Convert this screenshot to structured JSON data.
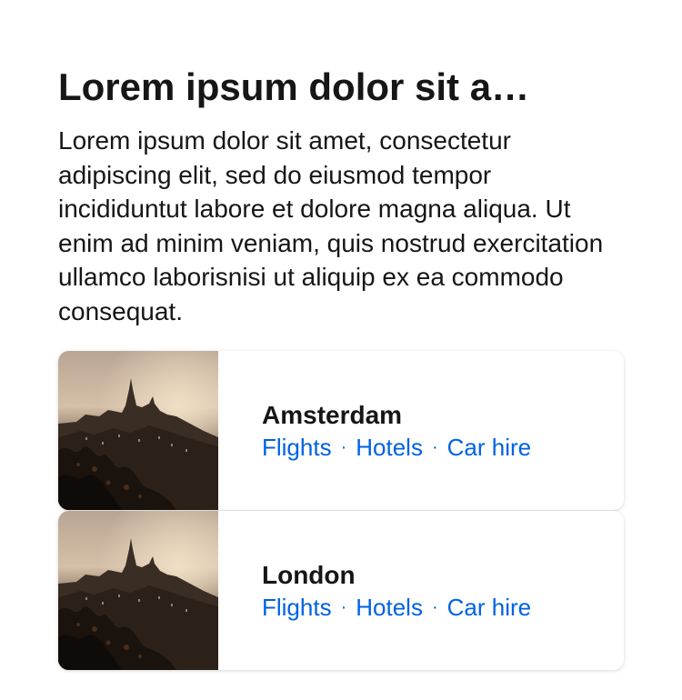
{
  "heading": "Lorem ipsum dolor sit a…",
  "body": "Lorem ipsum dolor sit amet, consectetur adipiscing elit, sed do eiusmod tempor incididuntut labore et dolore magna aliqua. Ut enim ad minim veniam, quis nostrud exercitation ullamco laborisnisi ut aliquip ex ea commodo consequat.",
  "colors": {
    "text": "#161616",
    "link": "#0062e3",
    "card_bg": "#ffffff"
  },
  "cards": [
    {
      "city": "Amsterdam",
      "image": "city-skyline-photo",
      "links": [
        "Flights",
        "Hotels",
        "Car hire"
      ],
      "separator": "·"
    },
    {
      "city": "London",
      "image": "city-skyline-photo",
      "links": [
        "Flights",
        "Hotels",
        "Car hire"
      ],
      "separator": "·"
    }
  ]
}
